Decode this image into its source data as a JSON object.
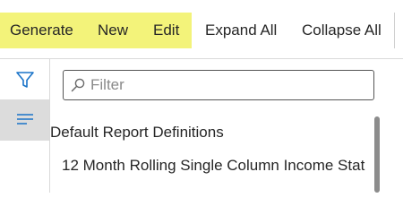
{
  "colors": {
    "highlight": "#f3f37a",
    "icon_accent": "#1a73c8",
    "active_rail_bg": "#dcdcdc"
  },
  "toolbar": {
    "generate_label": "Generate",
    "new_label": "New",
    "edit_label": "Edit",
    "expand_all_label": "Expand All",
    "collapse_all_label": "Collapse All"
  },
  "siderail": {
    "items": [
      {
        "icon": "filter-icon",
        "active": false
      },
      {
        "icon": "list-icon",
        "active": true
      }
    ]
  },
  "filter": {
    "placeholder": "Filter",
    "value": ""
  },
  "tree": {
    "group_label": "Default Report Definitions",
    "items": [
      {
        "label": "12 Month Rolling Single Column Income Stat"
      }
    ]
  }
}
